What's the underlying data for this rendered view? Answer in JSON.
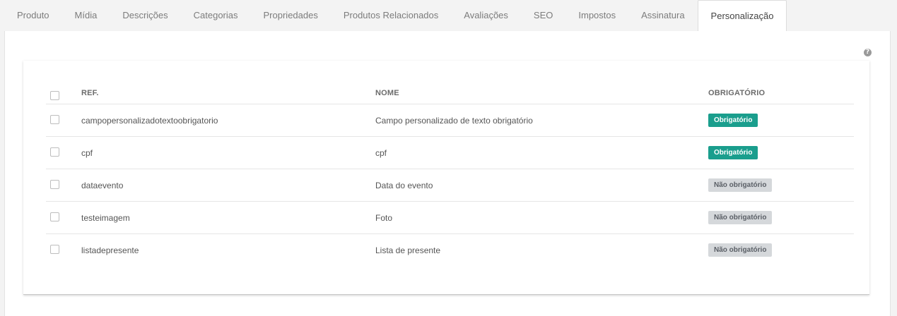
{
  "tabs": [
    {
      "label": "Produto"
    },
    {
      "label": "Mídia"
    },
    {
      "label": "Descrições"
    },
    {
      "label": "Categorias"
    },
    {
      "label": "Propriedades"
    },
    {
      "label": "Produtos Relacionados"
    },
    {
      "label": "Avaliações"
    },
    {
      "label": "SEO"
    },
    {
      "label": "Impostos"
    },
    {
      "label": "Assinatura"
    },
    {
      "label": "Personalização"
    }
  ],
  "active_tab": "Personalização",
  "help_icon": "question-circle-icon",
  "table": {
    "columns": {
      "ref": "REF.",
      "nome": "NOME",
      "obrigatorio": "OBRIGATÓRIO"
    },
    "rows": [
      {
        "ref": "campopersonalizadotextoobrigatorio",
        "nome": "Campo personalizado de texto obrigatório",
        "status": "Obrigatório",
        "required": true
      },
      {
        "ref": "cpf",
        "nome": "cpf",
        "status": "Obrigatório",
        "required": true
      },
      {
        "ref": "dataevento",
        "nome": "Data do evento",
        "status": "Não obrigatório",
        "required": false
      },
      {
        "ref": "testeimagem",
        "nome": "Foto",
        "status": "Não obrigatório",
        "required": false
      },
      {
        "ref": "listadepresente",
        "nome": "Lista de presente",
        "status": "Não obrigatório",
        "required": false
      }
    ]
  },
  "colors": {
    "required_badge": "#1a9e8d",
    "optional_badge": "#d5d8db"
  }
}
